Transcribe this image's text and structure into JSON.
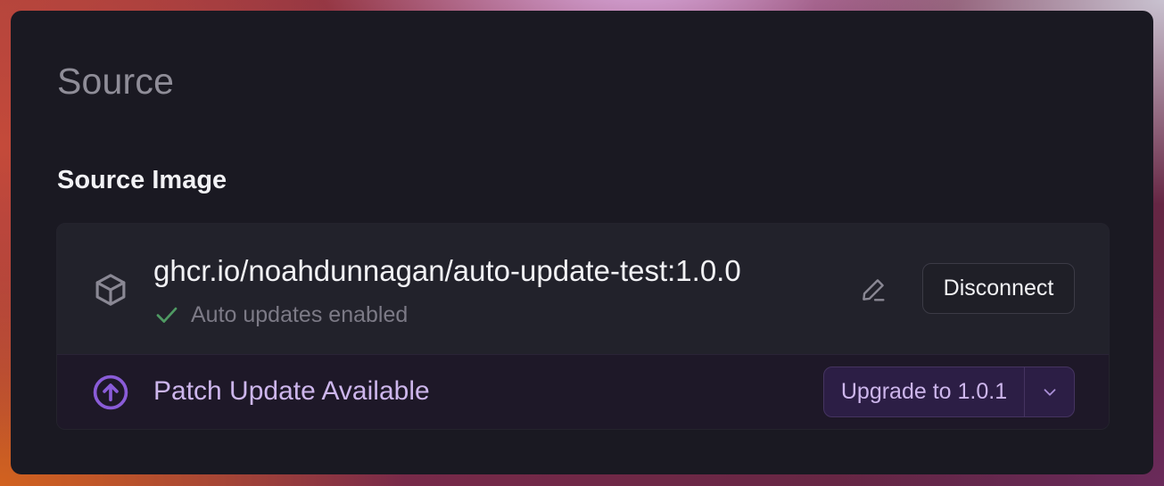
{
  "section": {
    "title": "Source",
    "subtitle": "Source Image"
  },
  "source_card": {
    "image_name": "ghcr.io/noahdunnagan/auto-update-test:1.0.0",
    "status_text": "Auto updates enabled",
    "disconnect_label": "Disconnect",
    "icons": {
      "image": "box-icon",
      "status": "check-icon",
      "edit": "pencil-icon"
    }
  },
  "update_banner": {
    "text": "Patch Update Available",
    "upgrade_label": "Upgrade to 1.0.1",
    "icons": {
      "update": "arrow-up-circle-icon",
      "menu": "chevron-down-icon"
    }
  },
  "colors": {
    "panel_bg": "#1a1922",
    "accent_purple": "#8a5cd8",
    "success_green": "#4f9a63",
    "text_primary": "#f2f2f5",
    "text_muted": "#8f8d98"
  }
}
